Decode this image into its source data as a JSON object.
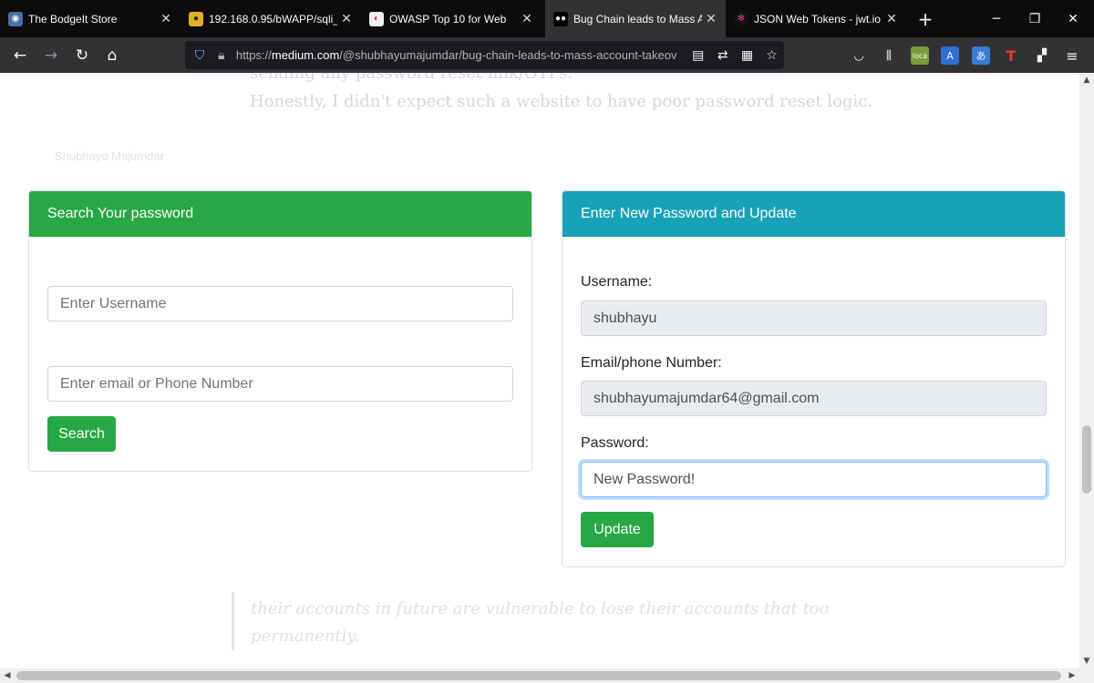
{
  "browser": {
    "tabs": [
      {
        "title": "The BodgeIt Store",
        "favicon": "globe-icon"
      },
      {
        "title": "192.168.0.95/bWAPP/sqli_6.p",
        "favicon": "bee-icon"
      },
      {
        "title": "OWASP Top 10 for Web",
        "favicon": "owasp-icon"
      },
      {
        "title": "Bug Chain leads to Mass Acc",
        "favicon": "medium-icon"
      },
      {
        "title": "JSON Web Tokens - jwt.io",
        "favicon": "jwt-icon"
      }
    ],
    "active_tab_index": 3,
    "url_prefix": "https://",
    "url_domain": "medium.com",
    "url_path": "/@shubhayumajumdar/bug-chain-leads-to-mass-account-takeov",
    "extension_badge": "loca"
  },
  "background": {
    "line1": "sending any password reset link/OTPs.",
    "line2": "Honestly, I didn't expect such a website to have poor password reset logic.",
    "caption": "Shubhayu Majumdar",
    "quote_line1": "their accounts in future are vulnerable to lose their accounts that too",
    "quote_line2": "permanently."
  },
  "search_card": {
    "title": "Search Your password",
    "username_placeholder": "Enter Username",
    "email_placeholder": "Enter email or Phone Number",
    "button": "Search",
    "header_color": "#28a745"
  },
  "update_card": {
    "title": "Enter New Password and Update",
    "username_label": "Username:",
    "username_value": "shubhayu",
    "email_label": "Email/phone Number:",
    "email_value": "shubhayumajumdar64@gmail.com",
    "password_label": "Password:",
    "password_value": "New Password!",
    "button": "Update",
    "header_color": "#17a2b8"
  }
}
